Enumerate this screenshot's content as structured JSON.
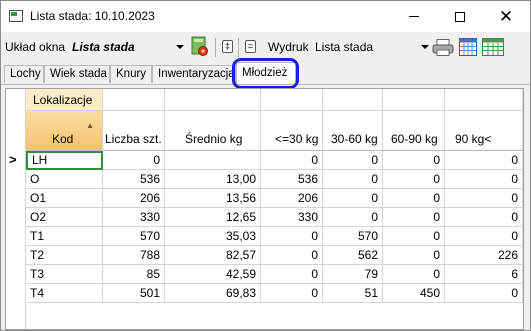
{
  "window": {
    "title": "Lista stada: 10.10.2023"
  },
  "toolbar": {
    "uklad_label": "Układ okna",
    "uklad_value": "Lista stada",
    "btn_a_label": "‡",
    "btn_b_label": "=",
    "wydruk_label": "Wydruk",
    "wydruk_value": "Lista stada"
  },
  "tabs": [
    {
      "label": "Lochy"
    },
    {
      "label": "Wiek stada"
    },
    {
      "label": "Knury"
    },
    {
      "label": "Inwentaryzacja"
    },
    {
      "label": "Młodzież",
      "active": true
    }
  ],
  "grid": {
    "group_header": "Lokalizacje",
    "columns": [
      "Kod",
      "Liczba szt.",
      "Średnio kg",
      "<=30 kg",
      "30-60 kg",
      "60-90 kg",
      "90 kg<"
    ],
    "current_row_marker": ">",
    "rows": [
      [
        "LH",
        "0",
        "",
        "0",
        "0",
        "0",
        "0"
      ],
      [
        "O",
        "536",
        "13,00",
        "536",
        "0",
        "0",
        "0"
      ],
      [
        "O1",
        "206",
        "13,56",
        "206",
        "0",
        "0",
        "0"
      ],
      [
        "O2",
        "330",
        "12,65",
        "330",
        "0",
        "0",
        "0"
      ],
      [
        "T1",
        "570",
        "35,03",
        "0",
        "570",
        "0",
        "0"
      ],
      [
        "T2",
        "788",
        "82,57",
        "0",
        "562",
        "0",
        "226"
      ],
      [
        "T3",
        "85",
        "42,59",
        "0",
        "79",
        "0",
        "6"
      ],
      [
        "T4",
        "501",
        "69,83",
        "0",
        "51",
        "450",
        "0"
      ]
    ]
  },
  "colors": {
    "highlight": "#1b1fd4",
    "selection": "#2f8f3a",
    "kod_header": "#f6c070"
  }
}
